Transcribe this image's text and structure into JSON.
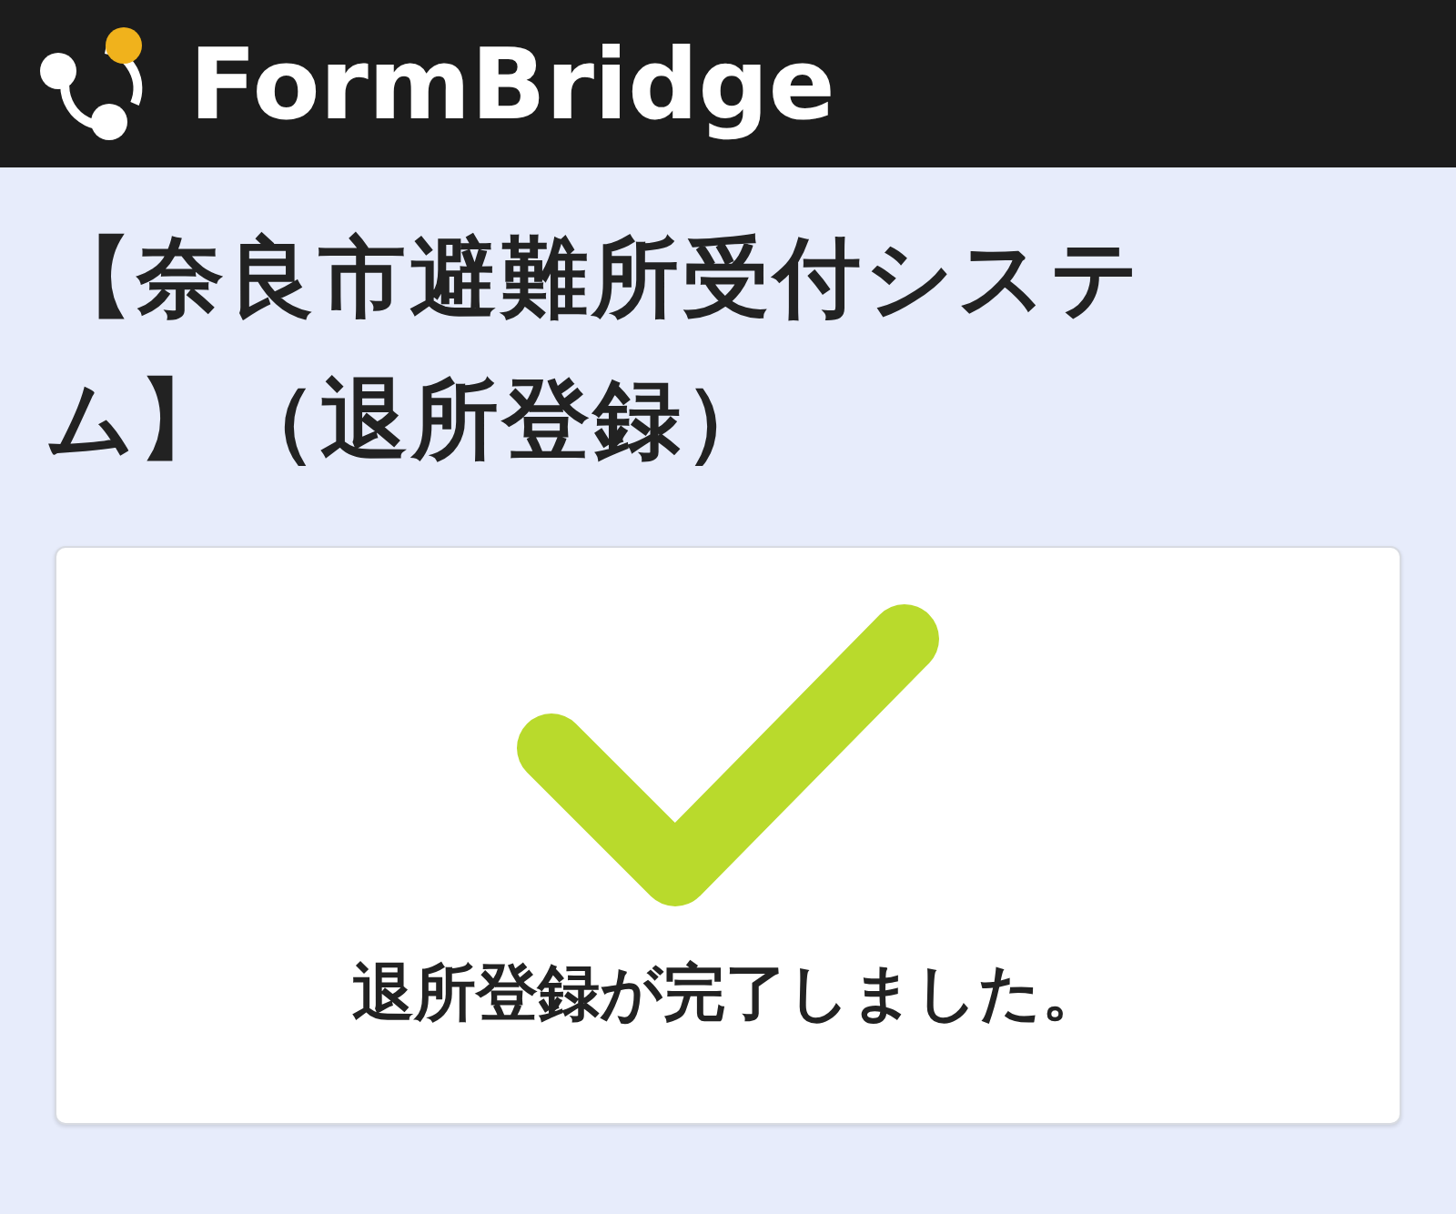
{
  "header": {
    "brand": "FormBridge"
  },
  "form": {
    "title": "【奈良市避難所受付システム】（退所登録）"
  },
  "result": {
    "completed": true,
    "message": "退所登録が完了しました。"
  }
}
